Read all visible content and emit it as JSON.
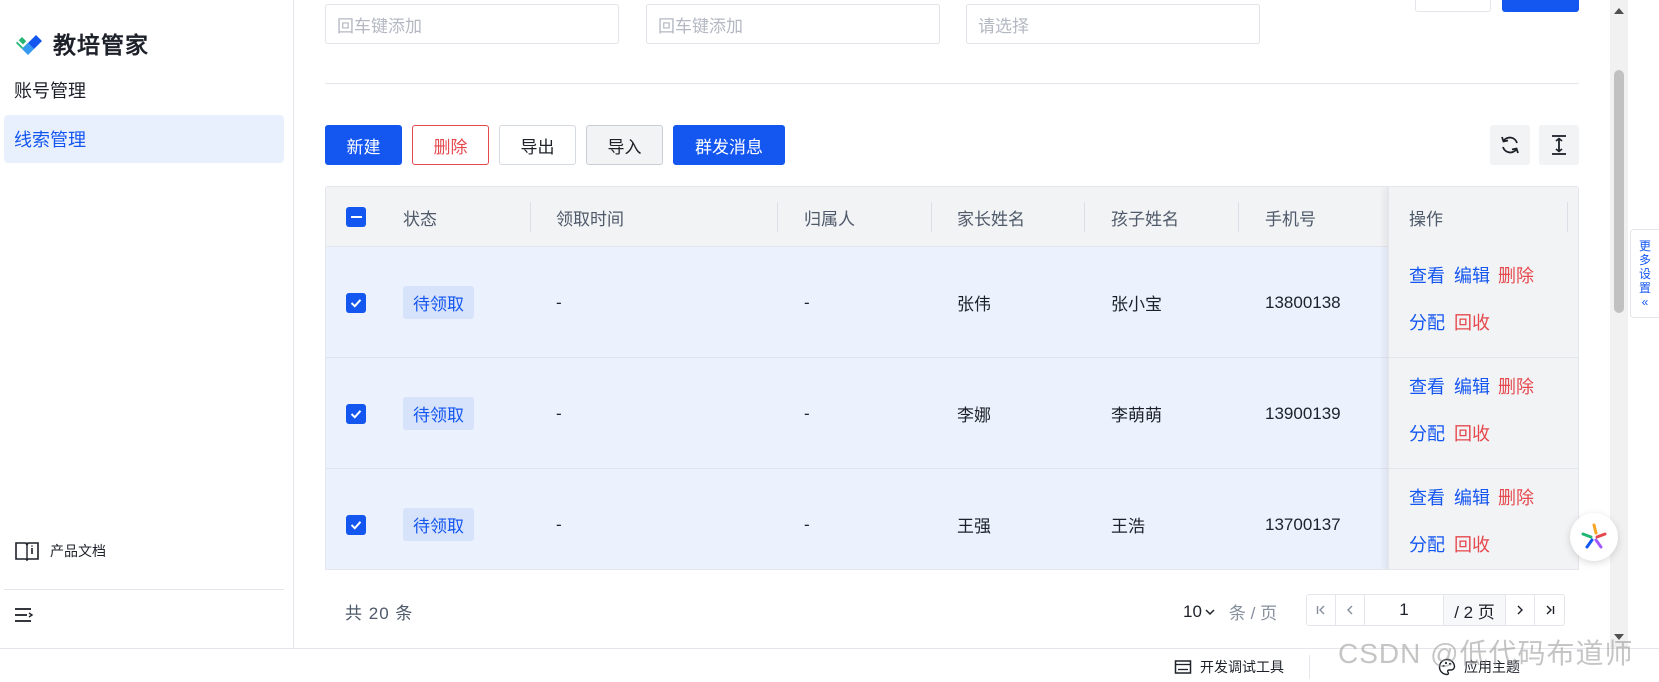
{
  "app": {
    "name": "教培管家"
  },
  "sidebar": {
    "items": [
      {
        "label": "账号管理",
        "active": false
      },
      {
        "label": "线索管理",
        "active": true
      }
    ],
    "doc_link": "产品文档"
  },
  "filters": [
    {
      "placeholder": "回车键添加"
    },
    {
      "placeholder": "回车键添加"
    },
    {
      "placeholder": "请选择"
    }
  ],
  "toolbar": {
    "new": "新建",
    "delete": "删除",
    "export": "导出",
    "import": "导入",
    "broadcast": "群发消息"
  },
  "table": {
    "columns": [
      "状态",
      "领取时间",
      "归属人",
      "家长姓名",
      "孩子姓名",
      "手机号",
      "操作"
    ],
    "rows": [
      {
        "status": "待领取",
        "claim_time": "-",
        "owner": "-",
        "parent": "张伟",
        "child": "张小宝",
        "phone": "13800138"
      },
      {
        "status": "待领取",
        "claim_time": "-",
        "owner": "-",
        "parent": "李娜",
        "child": "李萌萌",
        "phone": "13900139"
      },
      {
        "status": "待领取",
        "claim_time": "-",
        "owner": "-",
        "parent": "王强",
        "child": "王浩",
        "phone": "13700137"
      }
    ],
    "actions": {
      "view": "查看",
      "edit": "编辑",
      "delete": "删除",
      "assign": "分配",
      "recycle": "回收"
    }
  },
  "pagination": {
    "total_prefix": "共",
    "total": "20",
    "total_suffix": "条",
    "page_size": "10",
    "page_size_unit": "条 / 页",
    "current_page": "1",
    "total_pages": "/ 2 页"
  },
  "side_tab": {
    "chars": [
      "更",
      "多",
      "设",
      "置",
      "«"
    ]
  },
  "bottombar": {
    "devtools": "开发调试工具",
    "theme": "应用主题"
  },
  "watermark": "CSDN @低代码布道师",
  "colors": {
    "primary": "#1456f0",
    "danger": "#e5484d",
    "selected_row": "#ebf1fd"
  }
}
